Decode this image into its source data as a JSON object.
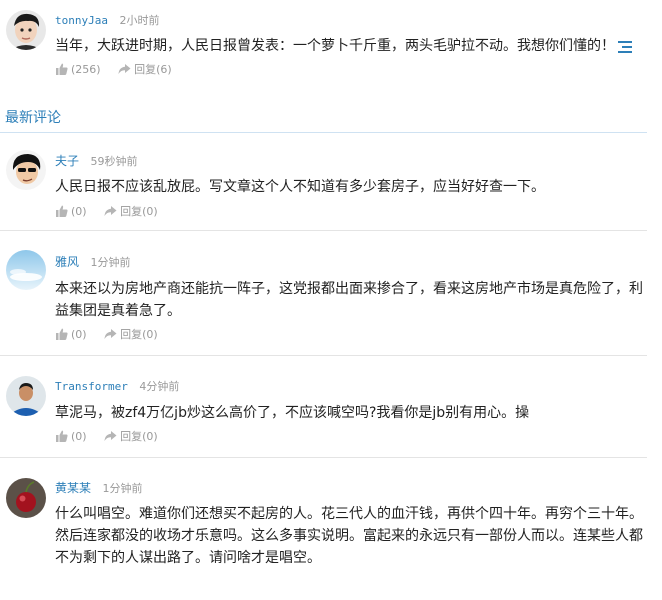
{
  "top_comment": {
    "user": "tonnyJaa",
    "time": "2小时前",
    "text": "当年，大跃进时期，人民日报曾发表：一个萝卜千斤重，两头毛驴拉不动。我想你们懂的！",
    "likes": "(256)",
    "reply_label": "回复",
    "replies": "(6)"
  },
  "section": {
    "title": "最新评论"
  },
  "comments": [
    {
      "user": "夫子",
      "time": "59秒钟前",
      "text": "人民日报不应该乱放屁。写文章这个人不知道有多少套房子，应当好好查一下。",
      "likes": "(0)",
      "reply_label": "回复",
      "replies": "(0)"
    },
    {
      "user": "雅风",
      "time": "1分钟前",
      "text": "本来还以为房地产商还能抗一阵子，这党报都出面来掺合了，看来这房地产市场是真危险了，利益集团是真着急了。",
      "likes": "(0)",
      "reply_label": "回复",
      "replies": "(0)"
    },
    {
      "user": "Transformer",
      "time": "4分钟前",
      "text": "草泥马，被zf4万亿jb炒这么高价了，不应该喊空吗?我看你是jb别有用心。操",
      "likes": "(0)",
      "reply_label": "回复",
      "replies": "(0)"
    },
    {
      "user": "黄某某",
      "time": "1分钟前",
      "text": "什么叫唱空。难道你们还想买不起房的人。花三代人的血汗钱，再供个四十年。再穷个三十年。然后连家都没的收场才乐意吗。这么多事实说明。富起来的永远只有一部份人而以。连某些人都不为剩下的人谋出路了。请问啥才是唱空。",
      "likes": "(0)",
      "reply_label": "回复",
      "replies": "(0)"
    }
  ]
}
